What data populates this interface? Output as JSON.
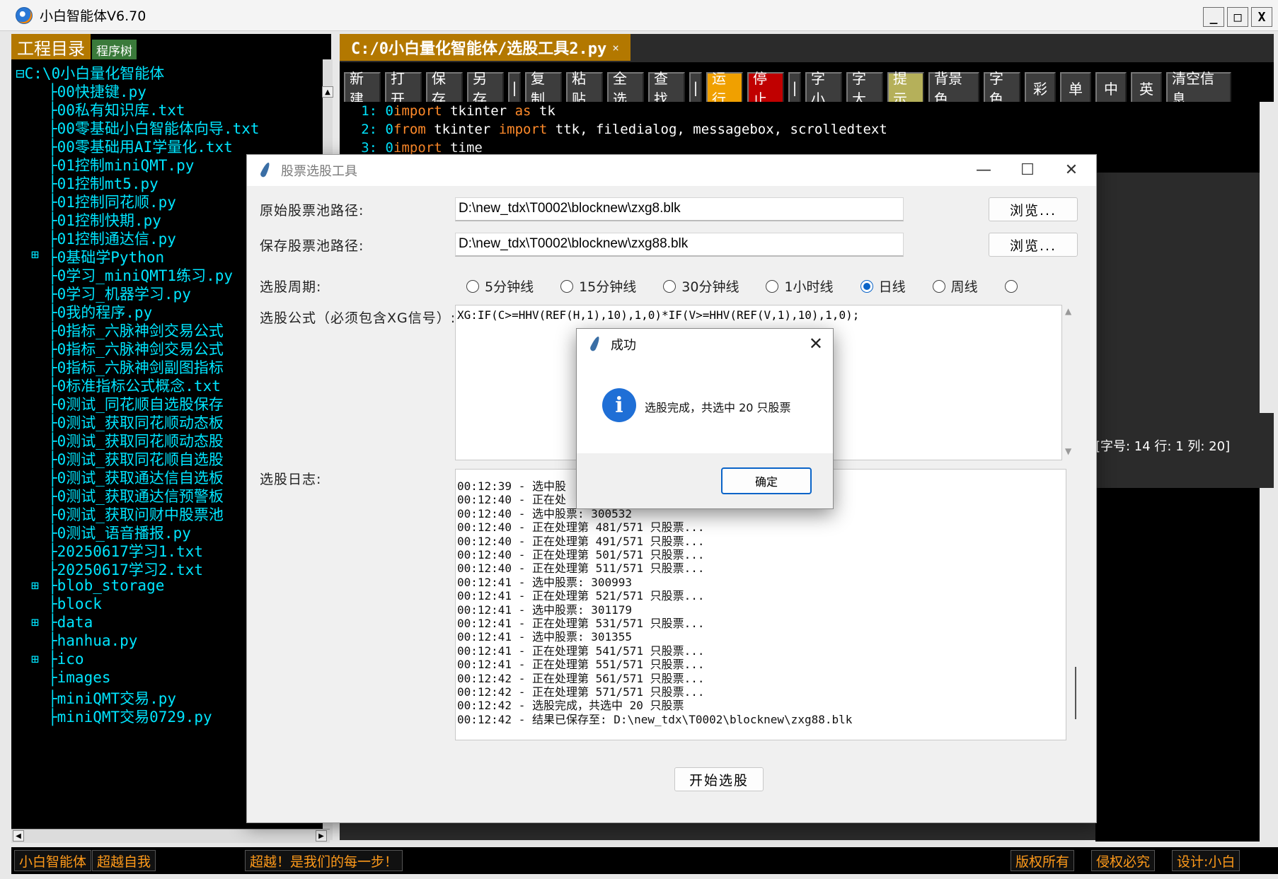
{
  "window": {
    "title": "小白智能体V6.70",
    "min": "_",
    "max": "□",
    "close": "X"
  },
  "left": {
    "tab_active": "工程目录",
    "tab_other": "程序树",
    "root": "⊟C:\\0小白量化智能体",
    "items": [
      {
        "label": "├00快捷键.py",
        "expand": ""
      },
      {
        "label": "├00私有知识库.txt",
        "expand": ""
      },
      {
        "label": "├00零基础小白智能体向导.txt",
        "expand": ""
      },
      {
        "label": "├00零基础用AI学量化.txt",
        "expand": ""
      },
      {
        "label": "├01控制miniQMT.py",
        "expand": ""
      },
      {
        "label": "├01控制mt5.py",
        "expand": ""
      },
      {
        "label": "├01控制同花顺.py",
        "expand": ""
      },
      {
        "label": "├01控制快期.py",
        "expand": ""
      },
      {
        "label": "├01控制通达信.py",
        "expand": ""
      },
      {
        "label": "├0基础学Python",
        "expand": "⊞"
      },
      {
        "label": "├0学习_miniQMT1练习.py",
        "expand": ""
      },
      {
        "label": "├0学习_机器学习.py",
        "expand": ""
      },
      {
        "label": "├0我的程序.py",
        "expand": ""
      },
      {
        "label": "├0指标_六脉神剑交易公式",
        "expand": ""
      },
      {
        "label": "├0指标_六脉神剑交易公式",
        "expand": ""
      },
      {
        "label": "├0指标_六脉神剑副图指标",
        "expand": ""
      },
      {
        "label": "├0标准指标公式概念.txt",
        "expand": ""
      },
      {
        "label": "├0测试_同花顺自选股保存",
        "expand": ""
      },
      {
        "label": "├0测试_获取同花顺动态板",
        "expand": ""
      },
      {
        "label": "├0测试_获取同花顺动态股",
        "expand": ""
      },
      {
        "label": "├0测试_获取同花顺自选股",
        "expand": ""
      },
      {
        "label": "├0测试_获取通达信自选板",
        "expand": ""
      },
      {
        "label": "├0测试_获取通达信预警板",
        "expand": ""
      },
      {
        "label": "├0测试_获取问财中股票池",
        "expand": ""
      },
      {
        "label": "├0测试_语音播报.py",
        "expand": ""
      },
      {
        "label": "├20250617学习1.txt",
        "expand": ""
      },
      {
        "label": "├20250617学习2.txt",
        "expand": ""
      },
      {
        "label": "├blob_storage",
        "expand": "⊞"
      },
      {
        "label": "├block",
        "expand": ""
      },
      {
        "label": "├data",
        "expand": "⊞"
      },
      {
        "label": "├hanhua.py",
        "expand": ""
      },
      {
        "label": "├ico",
        "expand": "⊞"
      },
      {
        "label": "├images",
        "expand": ""
      },
      {
        "label": "├miniQMT交易.py",
        "expand": ""
      },
      {
        "label": "├miniQMT交易0729.py",
        "expand": ""
      }
    ]
  },
  "editor": {
    "tab_title": "C:/0小白量化智能体/选股工具2.py",
    "tab_close": "×",
    "toolbar": [
      {
        "label": "新建",
        "bg": "#3d3d3d",
        "fg": "#ffffff"
      },
      {
        "label": "打开",
        "bg": "#3d3d3d",
        "fg": "#ffffff"
      },
      {
        "label": "保存",
        "bg": "#3d3d3d",
        "fg": "#ffffff"
      },
      {
        "label": "另存",
        "bg": "#3d3d3d",
        "fg": "#ffffff"
      },
      {
        "label": "|",
        "bg": "#3d3d3d",
        "fg": "#ffffff"
      },
      {
        "label": "复制",
        "bg": "#3d3d3d",
        "fg": "#ffffff"
      },
      {
        "label": "粘贴",
        "bg": "#3d3d3d",
        "fg": "#ffffff"
      },
      {
        "label": "全选",
        "bg": "#3d3d3d",
        "fg": "#ffffff"
      },
      {
        "label": "查找",
        "bg": "#3d3d3d",
        "fg": "#ffffff"
      },
      {
        "label": "|",
        "bg": "#3d3d3d",
        "fg": "#ffffff"
      },
      {
        "label": "运行",
        "bg": "#f0a000",
        "fg": "#ffffff"
      },
      {
        "label": "停止",
        "bg": "#c00000",
        "fg": "#ffffff"
      },
      {
        "label": "|",
        "bg": "#3d3d3d",
        "fg": "#ffffff"
      },
      {
        "label": "字小",
        "bg": "#3d3d3d",
        "fg": "#ffffff"
      },
      {
        "label": "字大",
        "bg": "#3d3d3d",
        "fg": "#ffffff"
      },
      {
        "label": "提示",
        "bg": "#b5b05a",
        "fg": "#ffffff"
      },
      {
        "label": "背景色",
        "bg": "#3d3d3d",
        "fg": "#ffffff"
      },
      {
        "label": "字色",
        "bg": "#3d3d3d",
        "fg": "#ffffff"
      },
      {
        "label": "彩",
        "bg": "#3d3d3d",
        "fg": "#ffffff"
      },
      {
        "label": "单",
        "bg": "#3d3d3d",
        "fg": "#ffffff"
      },
      {
        "label": "中",
        "bg": "#3d3d3d",
        "fg": "#ffffff"
      },
      {
        "label": "英",
        "bg": "#3d3d3d",
        "fg": "#ffffff"
      },
      {
        "label": "清空信息",
        "bg": "#3d3d3d",
        "fg": "#ffffff"
      }
    ],
    "code": [
      {
        "ln": "1: 0",
        "kw1": "import",
        "t1": " tkinter ",
        "kw2": "as",
        "t2": " tk"
      },
      {
        "ln": "2: 0",
        "kw1": "from",
        "t1": " tkinter ",
        "kw2": "import",
        "t2": " ttk, filedialog, messagebox, scrolledtext"
      },
      {
        "ln": "3: 0",
        "kw1": "import",
        "t1": " time",
        "kw2": "",
        "t2": ""
      }
    ],
    "status": "[字号: 14  行: 1  列: 20]"
  },
  "statusbar": [
    "小白智能体",
    "超越自我",
    "超越！是我们的每一步！",
    "版权所有",
    "侵权必究",
    "设计:小白"
  ],
  "tool": {
    "title": "股票选股工具",
    "win_min": "—",
    "win_max": "☐",
    "win_close": "✕",
    "src_label": "原始股票池路径:",
    "src_value": "D:\\new_tdx\\T0002\\blocknew\\zxg8.blk",
    "dst_label": "保存股票池路径:",
    "dst_value": "D:\\new_tdx\\T0002\\blocknew\\zxg88.blk",
    "browse": "浏览...",
    "period_label": "选股周期:",
    "periods": [
      {
        "label": "5分钟线",
        "on": false
      },
      {
        "label": "15分钟线",
        "on": false
      },
      {
        "label": "30分钟线",
        "on": false
      },
      {
        "label": "1小时线",
        "on": false
      },
      {
        "label": "日线",
        "on": true
      },
      {
        "label": "周线",
        "on": false
      },
      {
        "label": "",
        "on": false
      }
    ],
    "formula_label": "选股公式（必须包含XG信号）:",
    "formula": "XG:IF(C>=HHV(REF(H,1),10),1,0)*IF(V>=HHV(REF(V,1),10),1,0);",
    "log_label": "选股日志:",
    "log": [
      "00:12:39 - 选中股",
      "00:12:40 - 正在处",
      "00:12:40 - 选中股票: 300532",
      "00:12:40 - 正在处理第 481/571 只股票...",
      "00:12:40 - 正在处理第 491/571 只股票...",
      "00:12:40 - 正在处理第 501/571 只股票...",
      "00:12:40 - 正在处理第 511/571 只股票...",
      "00:12:41 - 选中股票: 300993",
      "00:12:41 - 正在处理第 521/571 只股票...",
      "00:12:41 - 选中股票: 301179",
      "00:12:41 - 正在处理第 531/571 只股票...",
      "00:12:41 - 选中股票: 301355",
      "00:12:41 - 正在处理第 541/571 只股票...",
      "00:12:41 - 正在处理第 551/571 只股票...",
      "00:12:42 - 正在处理第 561/571 只股票...",
      "00:12:42 - 正在处理第 571/571 只股票...",
      "00:12:42 - 选股完成，共选中 20 只股票",
      "00:12:42 - 结果已保存至: D:\\new_tdx\\T0002\\blocknew\\zxg88.blk"
    ],
    "start": "开始选股"
  },
  "msg": {
    "title": "成功",
    "close": "✕",
    "icon": "i",
    "text": "选股完成，共选中 20 只股票",
    "ok": "确定"
  }
}
